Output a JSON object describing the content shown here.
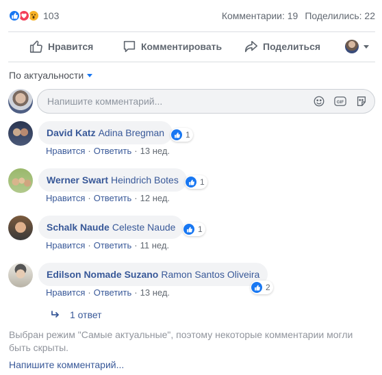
{
  "reactions": {
    "icons": [
      "like-icon",
      "love-icon",
      "wow-icon"
    ],
    "count": "103",
    "comments_text": "Комментарии: 19",
    "shares_text": "Поделились: 22"
  },
  "actions": {
    "like_label": "Нравится",
    "comment_label": "Комментировать",
    "share_label": "Поделиться"
  },
  "sort": {
    "label": "По актуальности"
  },
  "composer": {
    "placeholder": "Напишите комментарий..."
  },
  "comments": [
    {
      "author": "David Katz",
      "mention": "Adina Bregman",
      "reaction_count": "1",
      "like": "Нравится",
      "reply": "Ответить",
      "time": "13 нед."
    },
    {
      "author": "Werner Swart",
      "mention": "Heindrich Botes",
      "reaction_count": "1",
      "like": "Нравится",
      "reply": "Ответить",
      "time": "12 нед."
    },
    {
      "author": "Schalk Naude",
      "mention": "Celeste Naude",
      "reaction_count": "1",
      "like": "Нравится",
      "reply": "Ответить",
      "time": "11 нед."
    },
    {
      "author": "Edilson Nomade Suzano",
      "mention": "Ramon Santos Oliveira",
      "reaction_count": "2",
      "like": "Нравится",
      "reply": "Ответить",
      "time": "13 нед."
    }
  ],
  "replies": {
    "label": "1 ответ"
  },
  "notice": "Выбран режим \"Самые актуальные\", поэтому некоторые комментарии могли быть скрыты.",
  "write_comment": "Напишите комментарий...",
  "colors": {
    "accent": "#1877f2",
    "link": "#385898",
    "love": "#f33e58",
    "wow": "#f7b125"
  }
}
